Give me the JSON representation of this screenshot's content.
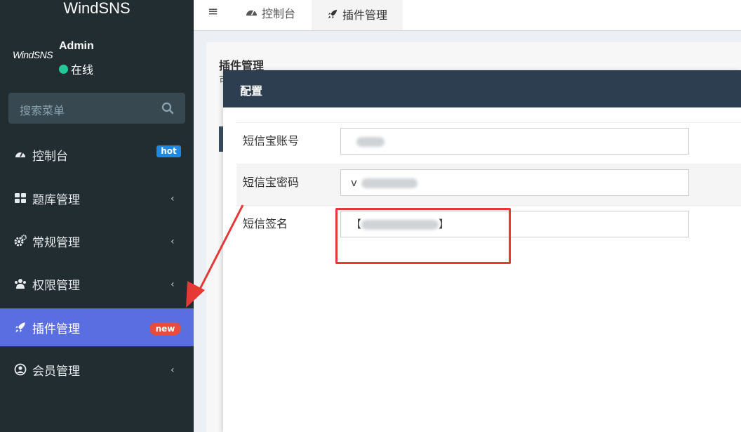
{
  "app": {
    "brand": "WindSNS"
  },
  "user": {
    "logo_text": "WindSNS",
    "name": "Admin",
    "status": "在线"
  },
  "search": {
    "placeholder": "搜索菜单"
  },
  "menu": [
    {
      "label": "控制台",
      "icon": "dashboard-icon",
      "badge": "hot"
    },
    {
      "label": "题库管理",
      "icon": "grid-icon",
      "chevron": "‹"
    },
    {
      "label": "常规管理",
      "icon": "gears-icon",
      "chevron": "‹"
    },
    {
      "label": "权限管理",
      "icon": "users-icon",
      "chevron": "‹"
    },
    {
      "label": "插件管理",
      "icon": "rocket-icon",
      "badge": "new",
      "active": true
    },
    {
      "label": "会员管理",
      "icon": "user-circle-icon",
      "chevron": "‹"
    }
  ],
  "topbar": {
    "menu_icon": "≡",
    "tabs": [
      {
        "label": "控制台",
        "icon": "dashboard-icon"
      },
      {
        "label": "插件管理",
        "icon": "rocket-icon",
        "active": true
      }
    ]
  },
  "content": {
    "title": "插件管理",
    "subtitle": "可"
  },
  "modal": {
    "title": "配置",
    "fields": [
      {
        "label": "短信宝账号",
        "value": ""
      },
      {
        "label": "短信宝密码",
        "value": "v"
      },
      {
        "label": "短信签名",
        "value_prefix": "【",
        "value_suffix": "】"
      }
    ]
  },
  "colors": {
    "sidebar_bg": "#222d32",
    "active_bg": "#5b6ee1",
    "hot_badge": "#1e88e5",
    "new_badge": "#e74c3c",
    "modal_header": "#2c3e50",
    "annotation_red": "#e53935"
  }
}
